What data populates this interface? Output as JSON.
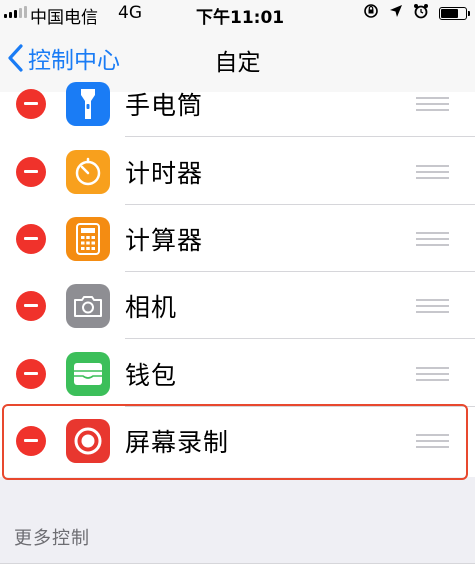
{
  "status_bar": {
    "carrier": "中国电信",
    "network": "4G",
    "time": "下午11:01",
    "icons": [
      "orientation-lock-icon",
      "location-arrow-icon",
      "alarm-clock-icon",
      "battery-icon"
    ],
    "battery_level": 0.75
  },
  "nav": {
    "back_label": "控制中心",
    "title": "自定"
  },
  "controls": [
    {
      "label": "手电筒",
      "icon": "flashlight-icon",
      "color": "#1a7cf5"
    },
    {
      "label": "计时器",
      "icon": "timer-icon",
      "color": "#f8a01d"
    },
    {
      "label": "计算器",
      "icon": "calculator-icon",
      "color": "#f48c12"
    },
    {
      "label": "相机",
      "icon": "camera-icon",
      "color": "#8e8e93"
    },
    {
      "label": "钱包",
      "icon": "wallet-icon",
      "color": "#3cbf5a"
    },
    {
      "label": "屏幕录制",
      "icon": "screen-recording-icon",
      "color": "#e8372f"
    }
  ],
  "highlighted_control": "屏幕录制",
  "highlight_color": "#e8482e",
  "section_header": "更多控制"
}
